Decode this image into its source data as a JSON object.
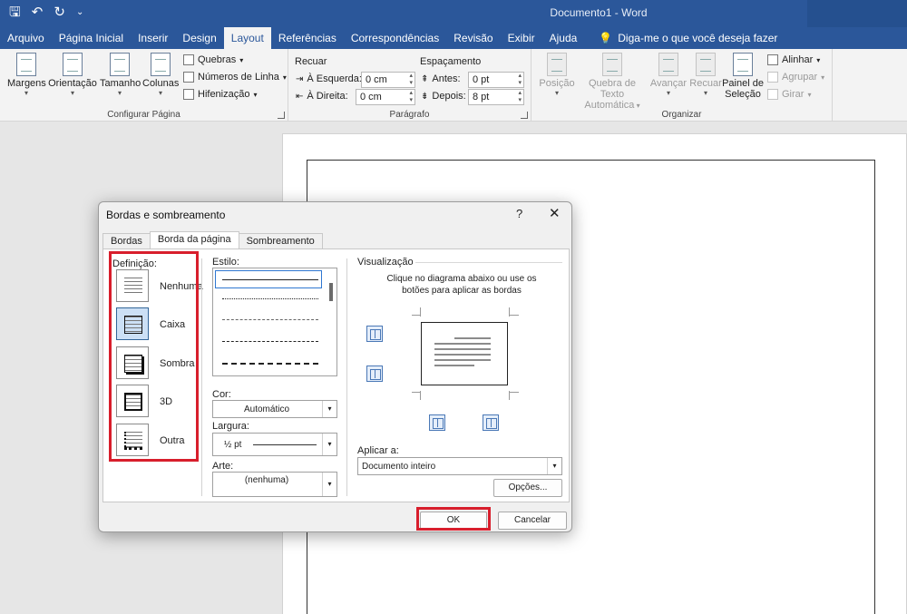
{
  "app": {
    "title": "Documento1  -  Word"
  },
  "tabs": [
    "Arquivo",
    "Página Inicial",
    "Inserir",
    "Design",
    "Layout",
    "Referências",
    "Correspondências",
    "Revisão",
    "Exibir",
    "Ajuda"
  ],
  "tell_me": "Diga-me o que você deseja fazer",
  "ribbon": {
    "page_setup": {
      "label": "Configurar Página",
      "margens": "Margens",
      "orientacao": "Orientação",
      "tamanho": "Tamanho",
      "colunas": "Colunas",
      "quebras": "Quebras",
      "numeros_linha": "Números de Linha",
      "hifenizacao": "Hifenização"
    },
    "paragraph": {
      "label": "Parágrafo",
      "recuar": "Recuar",
      "esquerda_label": "À Esquerda:",
      "esquerda_value": "0 cm",
      "direita_label": "À Direita:",
      "direita_value": "0 cm",
      "espacamento": "Espaçamento",
      "antes_label": "Antes:",
      "antes_value": "0 pt",
      "depois_label": "Depois:",
      "depois_value": "8 pt"
    },
    "arrange": {
      "label": "Organizar",
      "posicao": "Posição",
      "quebra_texto_1": "Quebra de Texto",
      "quebra_texto_2": "Automática",
      "avancar": "Avançar",
      "recuar": "Recuar",
      "painel_1": "Painel de",
      "painel_2": "Seleção",
      "alinhar": "Alinhar",
      "agrupar": "Agrupar",
      "girar": "Girar"
    }
  },
  "dialog": {
    "title": "Bordas e sombreamento",
    "help": "?",
    "close": "✕",
    "tabs": [
      "Bordas",
      "Borda da página",
      "Sombreamento"
    ],
    "definicao_label": "Definição:",
    "definitions": [
      "Nenhuma",
      "Caixa",
      "Sombra",
      "3D",
      "Outra"
    ],
    "estilo_label": "Estilo:",
    "cor_label": "Cor:",
    "cor_value": "Automático",
    "largura_label": "Largura:",
    "largura_value": "½ pt",
    "arte_label": "Arte:",
    "arte_value": "(nenhuma)",
    "visualizacao_label": "Visualização",
    "preview_hint_1": "Clique no diagrama abaixo ou use os",
    "preview_hint_2": "botões para aplicar as bordas",
    "aplicar_label": "Aplicar a:",
    "aplicar_value": "Documento inteiro",
    "opcoes": "Opções...",
    "ok": "OK",
    "cancelar": "Cancelar"
  },
  "colors": {
    "word_blue": "#2b579a",
    "highlight_red": "#d81e2c",
    "selection_blue": "#2f77d1"
  }
}
